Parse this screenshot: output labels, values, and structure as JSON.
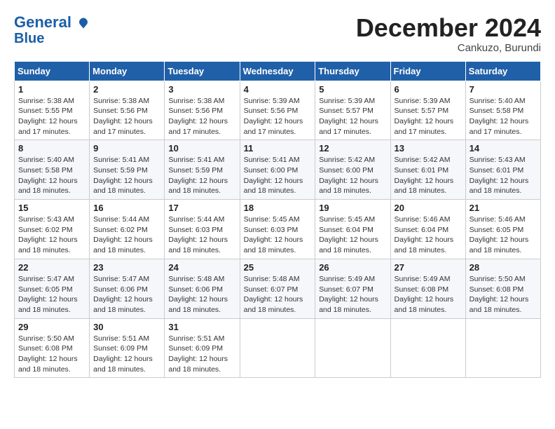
{
  "header": {
    "logo_line1": "General",
    "logo_line2": "Blue",
    "month_title": "December 2024",
    "location": "Cankuzo, Burundi"
  },
  "weekdays": [
    "Sunday",
    "Monday",
    "Tuesday",
    "Wednesday",
    "Thursday",
    "Friday",
    "Saturday"
  ],
  "weeks": [
    [
      {
        "day": "1",
        "sunrise": "Sunrise: 5:38 AM",
        "sunset": "Sunset: 5:55 PM",
        "daylight": "Daylight: 12 hours and 17 minutes."
      },
      {
        "day": "2",
        "sunrise": "Sunrise: 5:38 AM",
        "sunset": "Sunset: 5:56 PM",
        "daylight": "Daylight: 12 hours and 17 minutes."
      },
      {
        "day": "3",
        "sunrise": "Sunrise: 5:38 AM",
        "sunset": "Sunset: 5:56 PM",
        "daylight": "Daylight: 12 hours and 17 minutes."
      },
      {
        "day": "4",
        "sunrise": "Sunrise: 5:39 AM",
        "sunset": "Sunset: 5:56 PM",
        "daylight": "Daylight: 12 hours and 17 minutes."
      },
      {
        "day": "5",
        "sunrise": "Sunrise: 5:39 AM",
        "sunset": "Sunset: 5:57 PM",
        "daylight": "Daylight: 12 hours and 17 minutes."
      },
      {
        "day": "6",
        "sunrise": "Sunrise: 5:39 AM",
        "sunset": "Sunset: 5:57 PM",
        "daylight": "Daylight: 12 hours and 17 minutes."
      },
      {
        "day": "7",
        "sunrise": "Sunrise: 5:40 AM",
        "sunset": "Sunset: 5:58 PM",
        "daylight": "Daylight: 12 hours and 17 minutes."
      }
    ],
    [
      {
        "day": "8",
        "sunrise": "Sunrise: 5:40 AM",
        "sunset": "Sunset: 5:58 PM",
        "daylight": "Daylight: 12 hours and 18 minutes."
      },
      {
        "day": "9",
        "sunrise": "Sunrise: 5:41 AM",
        "sunset": "Sunset: 5:59 PM",
        "daylight": "Daylight: 12 hours and 18 minutes."
      },
      {
        "day": "10",
        "sunrise": "Sunrise: 5:41 AM",
        "sunset": "Sunset: 5:59 PM",
        "daylight": "Daylight: 12 hours and 18 minutes."
      },
      {
        "day": "11",
        "sunrise": "Sunrise: 5:41 AM",
        "sunset": "Sunset: 6:00 PM",
        "daylight": "Daylight: 12 hours and 18 minutes."
      },
      {
        "day": "12",
        "sunrise": "Sunrise: 5:42 AM",
        "sunset": "Sunset: 6:00 PM",
        "daylight": "Daylight: 12 hours and 18 minutes."
      },
      {
        "day": "13",
        "sunrise": "Sunrise: 5:42 AM",
        "sunset": "Sunset: 6:01 PM",
        "daylight": "Daylight: 12 hours and 18 minutes."
      },
      {
        "day": "14",
        "sunrise": "Sunrise: 5:43 AM",
        "sunset": "Sunset: 6:01 PM",
        "daylight": "Daylight: 12 hours and 18 minutes."
      }
    ],
    [
      {
        "day": "15",
        "sunrise": "Sunrise: 5:43 AM",
        "sunset": "Sunset: 6:02 PM",
        "daylight": "Daylight: 12 hours and 18 minutes."
      },
      {
        "day": "16",
        "sunrise": "Sunrise: 5:44 AM",
        "sunset": "Sunset: 6:02 PM",
        "daylight": "Daylight: 12 hours and 18 minutes."
      },
      {
        "day": "17",
        "sunrise": "Sunrise: 5:44 AM",
        "sunset": "Sunset: 6:03 PM",
        "daylight": "Daylight: 12 hours and 18 minutes."
      },
      {
        "day": "18",
        "sunrise": "Sunrise: 5:45 AM",
        "sunset": "Sunset: 6:03 PM",
        "daylight": "Daylight: 12 hours and 18 minutes."
      },
      {
        "day": "19",
        "sunrise": "Sunrise: 5:45 AM",
        "sunset": "Sunset: 6:04 PM",
        "daylight": "Daylight: 12 hours and 18 minutes."
      },
      {
        "day": "20",
        "sunrise": "Sunrise: 5:46 AM",
        "sunset": "Sunset: 6:04 PM",
        "daylight": "Daylight: 12 hours and 18 minutes."
      },
      {
        "day": "21",
        "sunrise": "Sunrise: 5:46 AM",
        "sunset": "Sunset: 6:05 PM",
        "daylight": "Daylight: 12 hours and 18 minutes."
      }
    ],
    [
      {
        "day": "22",
        "sunrise": "Sunrise: 5:47 AM",
        "sunset": "Sunset: 6:05 PM",
        "daylight": "Daylight: 12 hours and 18 minutes."
      },
      {
        "day": "23",
        "sunrise": "Sunrise: 5:47 AM",
        "sunset": "Sunset: 6:06 PM",
        "daylight": "Daylight: 12 hours and 18 minutes."
      },
      {
        "day": "24",
        "sunrise": "Sunrise: 5:48 AM",
        "sunset": "Sunset: 6:06 PM",
        "daylight": "Daylight: 12 hours and 18 minutes."
      },
      {
        "day": "25",
        "sunrise": "Sunrise: 5:48 AM",
        "sunset": "Sunset: 6:07 PM",
        "daylight": "Daylight: 12 hours and 18 minutes."
      },
      {
        "day": "26",
        "sunrise": "Sunrise: 5:49 AM",
        "sunset": "Sunset: 6:07 PM",
        "daylight": "Daylight: 12 hours and 18 minutes."
      },
      {
        "day": "27",
        "sunrise": "Sunrise: 5:49 AM",
        "sunset": "Sunset: 6:08 PM",
        "daylight": "Daylight: 12 hours and 18 minutes."
      },
      {
        "day": "28",
        "sunrise": "Sunrise: 5:50 AM",
        "sunset": "Sunset: 6:08 PM",
        "daylight": "Daylight: 12 hours and 18 minutes."
      }
    ],
    [
      {
        "day": "29",
        "sunrise": "Sunrise: 5:50 AM",
        "sunset": "Sunset: 6:08 PM",
        "daylight": "Daylight: 12 hours and 18 minutes."
      },
      {
        "day": "30",
        "sunrise": "Sunrise: 5:51 AM",
        "sunset": "Sunset: 6:09 PM",
        "daylight": "Daylight: 12 hours and 18 minutes."
      },
      {
        "day": "31",
        "sunrise": "Sunrise: 5:51 AM",
        "sunset": "Sunset: 6:09 PM",
        "daylight": "Daylight: 12 hours and 18 minutes."
      },
      null,
      null,
      null,
      null
    ]
  ]
}
